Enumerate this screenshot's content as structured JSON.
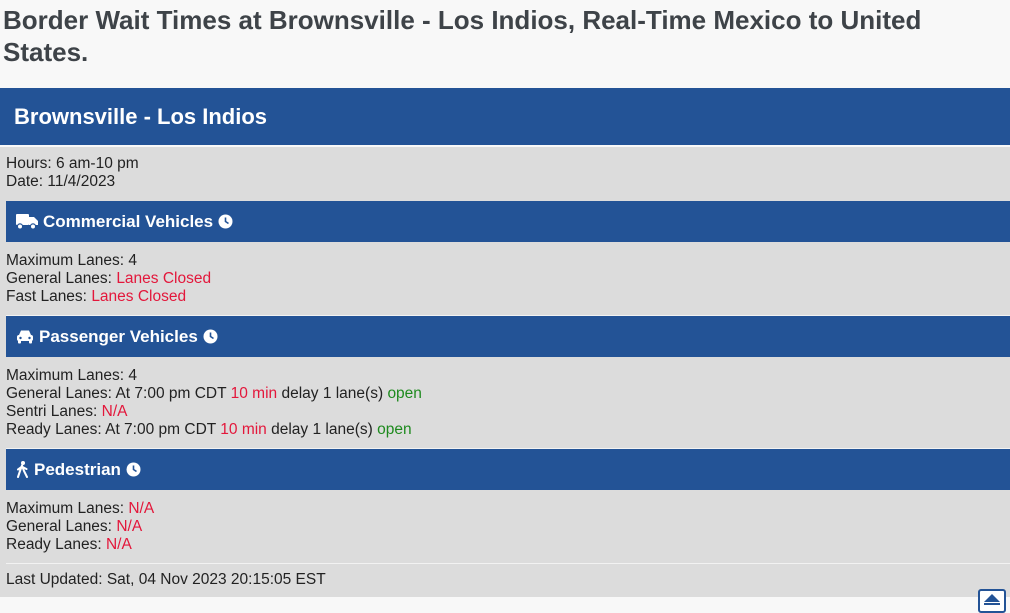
{
  "page": {
    "title": "Border Wait Times at Brownsville - Los Indios, Real-Time Mexico to United States."
  },
  "station": {
    "name": "Brownsville - Los Indios",
    "hours_label": "Hours:",
    "hours": "6 am-10 pm",
    "date_label": "Date:",
    "date": "11/4/2023"
  },
  "commercial": {
    "title": "Commercial Vehicles",
    "icon": "truck-icon",
    "max_label": "Maximum Lanes:",
    "max_value": "4",
    "general_label": "General Lanes:",
    "general_value": "Lanes Closed",
    "fast_label": "Fast Lanes:",
    "fast_value": "Lanes Closed"
  },
  "passenger": {
    "title": "Passenger Vehicles",
    "icon": "car-icon",
    "max_label": "Maximum Lanes:",
    "max_value": "4",
    "general_label": "General Lanes:",
    "general_time": "At 7:00 pm CDT",
    "general_delay": "10 min",
    "general_delay_suffix": "delay 1 lane(s)",
    "general_status": "open",
    "sentri_label": "Sentri Lanes:",
    "sentri_value": "N/A",
    "ready_label": "Ready Lanes:",
    "ready_time": "At 7:00 pm CDT",
    "ready_delay": "10 min",
    "ready_delay_suffix": "delay 1 lane(s)",
    "ready_status": "open"
  },
  "pedestrian": {
    "title": "Pedestrian",
    "icon": "walking-icon",
    "max_label": "Maximum Lanes:",
    "max_value": "N/A",
    "general_label": "General Lanes:",
    "general_value": "N/A",
    "ready_label": "Ready Lanes:",
    "ready_value": "N/A"
  },
  "footer": {
    "updated_label": "Last Updated:",
    "updated_value": "Sat, 04 Nov 2023 20:15:05 EST"
  },
  "colors": {
    "accent": "#235396",
    "alert": "#e3173b",
    "ok": "#1e8a1e",
    "panel": "#dcdcdc"
  }
}
